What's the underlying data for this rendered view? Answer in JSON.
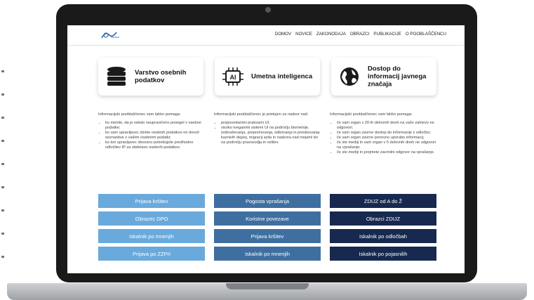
{
  "nav": {
    "logo_icon": "organisation-logo-icon",
    "links": [
      "DOMOV",
      "NOVICE",
      "ZAKONODAJA",
      "OBRAZCI",
      "PUBLIKACIJE",
      "O POOBLAŠČENCU"
    ]
  },
  "cards": [
    {
      "icon": "database-icon",
      "title": "Varstvo osebnih podatkov"
    },
    {
      "icon": "ai-chip-icon",
      "icon_label": "AI",
      "title": "Umetna inteligenca"
    },
    {
      "icon": "globe-icon",
      "title": "Dostop do informacij javnega značaja"
    }
  ],
  "columns": [
    {
      "intro": "Informacijski pooblaščenec vam lahko pomaga:",
      "items": [
        "ko menite, da je nekdo neupravičeno posegel v osebne podatke;",
        "ko vam upravljavec zbirke osebnih podatkov ne dovoli seznanitve z vašimi osebnimi podatki;",
        "ko kot upravljavec obvezno potrebujete predhodno odločitev IP za obdelavo osebnih podatkov."
      ]
    },
    {
      "intro": "Informacijski pooblaščenec je pristojen za nadzor nad:",
      "items": [
        "prepovedanimi praksami UI;",
        "visoko tveganimi sistemi UI na področju biometrije, izobraževanja, preprečevanja, odkrivanja in preiskovanja kaznivih dejanj, migracij azila in nadzora nad mejami ter na področju pravosodja in volitev."
      ]
    },
    {
      "intro": "Informacijski pooblaščenec vam lahko pomaga:",
      "items": [
        "če vam organ v 20-ih delovnih dneh na vašo zahtevo ne odgovori;",
        "če vam organ zavrne dostop do informacije z odločbo;",
        "če vam organ zavrne ponovno uporabo informacij;",
        "če ste mediji in vam organ v 5 delovnih dneh ne odgovori na vprašanje;",
        "če ste mediji in prejmete zavrnilni odgovor na vprašanje."
      ]
    }
  ],
  "buttons": [
    [
      "Prijava kršitev",
      "Obrazec DPO",
      "Iskalnik po mnenjih",
      "Prijava po ZZPri"
    ],
    [
      "Pogosta vprašanja",
      "Koristne povezave",
      "Prijava kršitev",
      "Iskalnik po mnenjih"
    ],
    [
      "ZDIJZ od A do Ž",
      "Obrazci ZDIJZ",
      "Iskalnik po odločbah",
      "Iskalnik po pojasnilih"
    ]
  ],
  "colors": {
    "column1": "#6aa9dc",
    "column2": "#3f6fa0",
    "column3": "#17294f"
  }
}
